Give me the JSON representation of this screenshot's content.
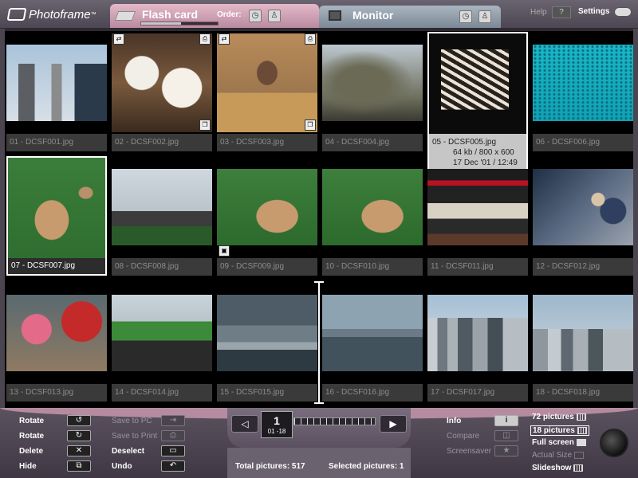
{
  "app": {
    "brand": "Photoframe",
    "brand_tm": "™"
  },
  "tabs": {
    "flash_card": {
      "title": "Flash card",
      "order_label": "Order:",
      "progress": 0.52
    },
    "monitor": {
      "title": "Monitor"
    }
  },
  "header": {
    "help_label": "Help",
    "help_btn": "?",
    "settings_label": "Settings"
  },
  "thumbnails": [
    {
      "label": "01 - DCSF001.jpg"
    },
    {
      "label": "02 - DCSF002.jpg"
    },
    {
      "label": "03 - DCSF003.jpg"
    },
    {
      "label": "04 - DCSF004.jpg"
    },
    {
      "label": "05 - DCSF005.jpg",
      "info_size": "64 kb / 800 x 600",
      "info_date": "17 Dec '01 / 12:49"
    },
    {
      "label": "06 - DCSF006.jpg"
    },
    {
      "label": "07 - DCSF007.jpg"
    },
    {
      "label": "08 - DCSF008.jpg"
    },
    {
      "label": "09 - DCSF009.jpg"
    },
    {
      "label": "10 - DCSF010.jpg"
    },
    {
      "label": "11 - DCSF011.jpg"
    },
    {
      "label": "12 - DCSF012.jpg"
    },
    {
      "label": "13 - DCSF013.jpg"
    },
    {
      "label": "14 - DCSF014.jpg"
    },
    {
      "label": "15 - DCSF015.jpg"
    },
    {
      "label": "16 - DCSF016.jpg"
    },
    {
      "label": "17 - DCSF017.jpg"
    },
    {
      "label": "18 - DCSF018.jpg"
    }
  ],
  "actions": {
    "rotate_ccw": "Rotate",
    "rotate_cw": "Rotate",
    "delete": "Delete",
    "hide": "Hide",
    "save_to_pc": "Save to PC",
    "save_to_print": "Save to Print",
    "deselect": "Deselect",
    "undo": "Undo"
  },
  "pager": {
    "page": "1",
    "range": "01 -18",
    "prev": "◁",
    "next": "▶"
  },
  "status": {
    "total": "Total pictures: 517",
    "selected": "Selected pictures: 1"
  },
  "view": {
    "info": "Info",
    "info_btn": "i",
    "compare": "Compare",
    "screensaver": "Screensaver",
    "pics72": "72 pictures",
    "pics18": "18 pictures",
    "fullscreen": "Full screen",
    "actual_size": "Actual Size",
    "slideshow": "Slideshow"
  }
}
